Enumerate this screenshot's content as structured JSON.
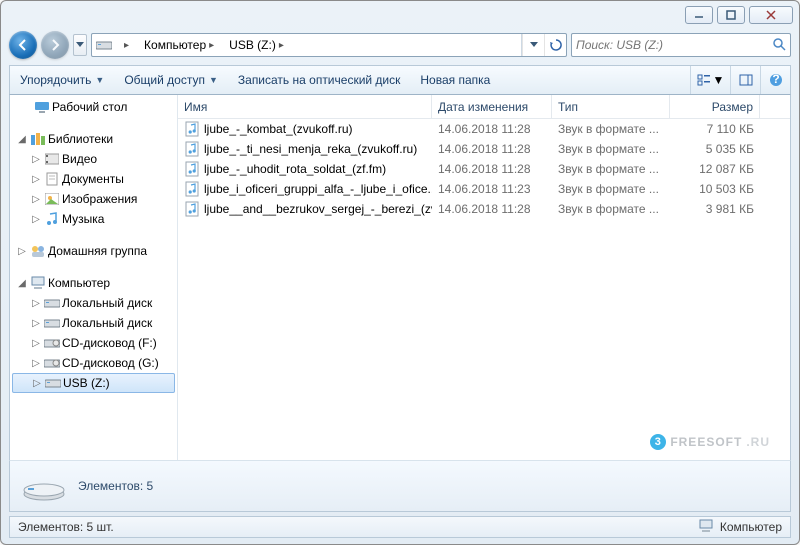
{
  "breadcrumb": {
    "root": "Компьютер",
    "current": "USB (Z:)"
  },
  "search": {
    "placeholder": "Поиск: USB (Z:)"
  },
  "toolbar": {
    "organize": "Упорядочить",
    "share": "Общий доступ",
    "burn": "Записать на оптический диск",
    "newfolder": "Новая папка"
  },
  "tree": {
    "desktop": "Рабочий стол",
    "libraries": "Библиотеки",
    "videos": "Видео",
    "documents": "Документы",
    "pictures": "Изображения",
    "music": "Музыка",
    "homegroup": "Домашняя группа",
    "computer": "Компьютер",
    "localdisk1": "Локальный диск",
    "localdisk2": "Локальный диск",
    "cddrive_f": "CD-дисковод (F:)",
    "cddrive_g": "CD-дисковод (G:)",
    "usb": "USB (Z:)"
  },
  "columns": {
    "name": "Имя",
    "date": "Дата изменения",
    "type": "Тип",
    "size": "Размер"
  },
  "files": [
    {
      "name": "ljube_-_kombat_(zvukoff.ru)",
      "date": "14.06.2018 11:28",
      "type": "Звук в формате ...",
      "size": "7 110 КБ"
    },
    {
      "name": "ljube_-_ti_nesi_menja_reka_(zvukoff.ru)",
      "date": "14.06.2018 11:28",
      "type": "Звук в формате ...",
      "size": "5 035 КБ"
    },
    {
      "name": "ljube_-_uhodit_rota_soldat_(zf.fm)",
      "date": "14.06.2018 11:28",
      "type": "Звук в формате ...",
      "size": "12 087 КБ"
    },
    {
      "name": "ljube_i_oficeri_gruppi_alfa_-_ljube_i_ofice...",
      "date": "14.06.2018 11:23",
      "type": "Звук в формате ...",
      "size": "10 503 КБ"
    },
    {
      "name": "ljube__and__bezrukov_sergej_-_berezi_(zv...",
      "date": "14.06.2018 11:28",
      "type": "Звук в формате ...",
      "size": "3 981 КБ"
    }
  ],
  "details": {
    "label": "Элементов: 5"
  },
  "status": {
    "left": "Элементов: 5 шт.",
    "right": "Компьютер"
  },
  "watermark": {
    "brand": "FREESOFT",
    "tld": ".RU"
  }
}
